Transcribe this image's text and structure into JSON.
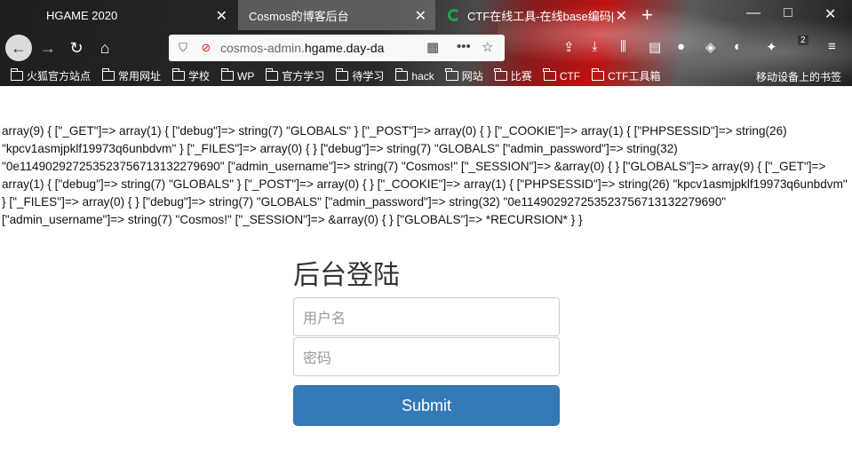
{
  "tabs": [
    {
      "label": "HGAME 2020",
      "active": false
    },
    {
      "label": "Cosmos的博客后台",
      "active": true
    },
    {
      "label": "CTF在线工具-在线base编码|在线",
      "active": false
    }
  ],
  "window": {
    "minimize": "—",
    "maximize": "□",
    "close": "✕"
  },
  "url": {
    "prefix": "cosmos-admin.",
    "domain": "hgame.day-da",
    "suffix": ""
  },
  "notification_count": "2",
  "bookmarks": [
    {
      "label": "火狐官方站点",
      "type": "site"
    },
    {
      "label": "常用网址",
      "type": "folder"
    },
    {
      "label": "学校",
      "type": "folder"
    },
    {
      "label": "WP",
      "type": "folder"
    },
    {
      "label": "官方学习",
      "type": "folder"
    },
    {
      "label": "待学习",
      "type": "folder"
    },
    {
      "label": "hack",
      "type": "folder"
    },
    {
      "label": "网站",
      "type": "folder"
    },
    {
      "label": "比赛",
      "type": "folder"
    },
    {
      "label": "CTF",
      "type": "folder"
    },
    {
      "label": "CTF工具箱",
      "type": "folder"
    }
  ],
  "bookmarks_mobile": "移动设备上的书签",
  "dump_text": "array(9) { [\"_GET\"]=> array(1) { [\"debug\"]=> string(7) \"GLOBALS\" } [\"_POST\"]=> array(0) { } [\"_COOKIE\"]=> array(1) { [\"PHPSESSID\"]=> string(26) \"kpcv1asmjpklf19973q6unbdvm\" } [\"_FILES\"]=> array(0) { } [\"debug\"]=> string(7) \"GLOBALS\" [\"admin_password\"]=> string(32) \"0e114902927253523756713132279690\" [\"admin_username\"]=> string(7) \"Cosmos!\" [\"_SESSION\"]=> &array(0) { } [\"GLOBALS\"]=> array(9) { [\"_GET\"]=> array(1) { [\"debug\"]=> string(7) \"GLOBALS\" } [\"_POST\"]=> array(0) { } [\"_COOKIE\"]=> array(1) { [\"PHPSESSID\"]=> string(26) \"kpcv1asmjpklf19973q6unbdvm\" } [\"_FILES\"]=> array(0) { } [\"debug\"]=> string(7) \"GLOBALS\" [\"admin_password\"]=> string(32) \"0e114902927253523756713132279690\" [\"admin_username\"]=> string(7) \"Cosmos!\" [\"_SESSION\"]=> &array(0) { } [\"GLOBALS\"]=> *RECURSION* } }",
  "login": {
    "title": "后台登陆",
    "username_placeholder": "用户名",
    "password_placeholder": "密码",
    "submit_label": "Submit"
  },
  "colors": {
    "primary_button": "#337ab7"
  }
}
